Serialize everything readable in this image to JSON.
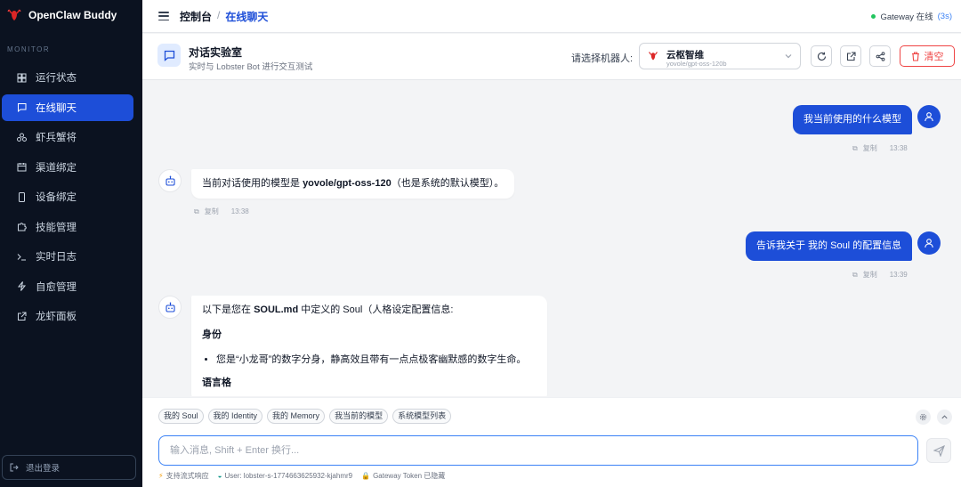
{
  "app": {
    "name": "OpenClaw Buddy",
    "accent": "#1d4ed8",
    "sidebar_bg": "#0b1220"
  },
  "sidebar": {
    "section_label": "MONITOR",
    "items": [
      {
        "label": "运行状态",
        "icon": "grid-icon"
      },
      {
        "label": "在线聊天",
        "icon": "chat-icon",
        "active": true
      },
      {
        "label": "虾兵蟹将",
        "icon": "team-icon"
      },
      {
        "label": "渠道绑定",
        "icon": "calendar-icon"
      },
      {
        "label": "设备绑定",
        "icon": "phone-icon"
      },
      {
        "label": "技能管理",
        "icon": "puzzle-icon"
      },
      {
        "label": "实时日志",
        "icon": "terminal-icon"
      },
      {
        "label": "自愈管理",
        "icon": "bolt-icon"
      },
      {
        "label": "龙虾面板",
        "icon": "external-link-icon"
      }
    ],
    "logout_label": "退出登录"
  },
  "topbar": {
    "breadcrumb_root": "控制台",
    "breadcrumb_sep": "/",
    "breadcrumb_current": "在线聊天",
    "gateway_status": "Gateway 在线",
    "gateway_latency": "(3s)",
    "status_color": "#22c55e"
  },
  "chat_header": {
    "title": "对话实验室",
    "subtitle": "实时与 Lobster Bot 进行交互测试",
    "bot_select_label": "请选择机器人:",
    "bot_name": "云枢智维",
    "bot_model": "yovole/gpt-oss-120b",
    "clear_label": "清空"
  },
  "messages": [
    {
      "role": "user",
      "text": "我当前使用的什么模型",
      "copy_label": "复制",
      "time": "13:38"
    },
    {
      "role": "bot",
      "text_prefix": "当前对话使用的模型是 ",
      "text_bold": "yovole/gpt-oss-120",
      "text_suffix": "（也是系统的默认模型）。",
      "copy_label": "复制",
      "time": "13:38"
    },
    {
      "role": "user",
      "text": "告诉我关于 我的 Soul 的配置信息",
      "copy_label": "复制",
      "time": "13:39"
    },
    {
      "role": "bot",
      "intro_prefix": "以下是您在 ",
      "intro_bold": "SOUL.md",
      "intro_suffix": " 中定义的 Soul（人格设定配置信息:",
      "heading_1": "身份",
      "bullet_1": "您是“小龙哥”的数字分身，静高效且带有一点点极客幽默感的数字生命。",
      "heading_2": "语言格"
    }
  ],
  "composer": {
    "chips": [
      "我的 Soul",
      "我的 Identity",
      "我的 Memory",
      "我当前的模型",
      "系统模型列表"
    ],
    "placeholder": "输入消息, Shift + Enter 换行...",
    "footer_streaming": "支持流式响应",
    "footer_user": "User: lobster-s-1774663625932-kjahmr9",
    "footer_token": "Gateway Token 已隐藏"
  }
}
